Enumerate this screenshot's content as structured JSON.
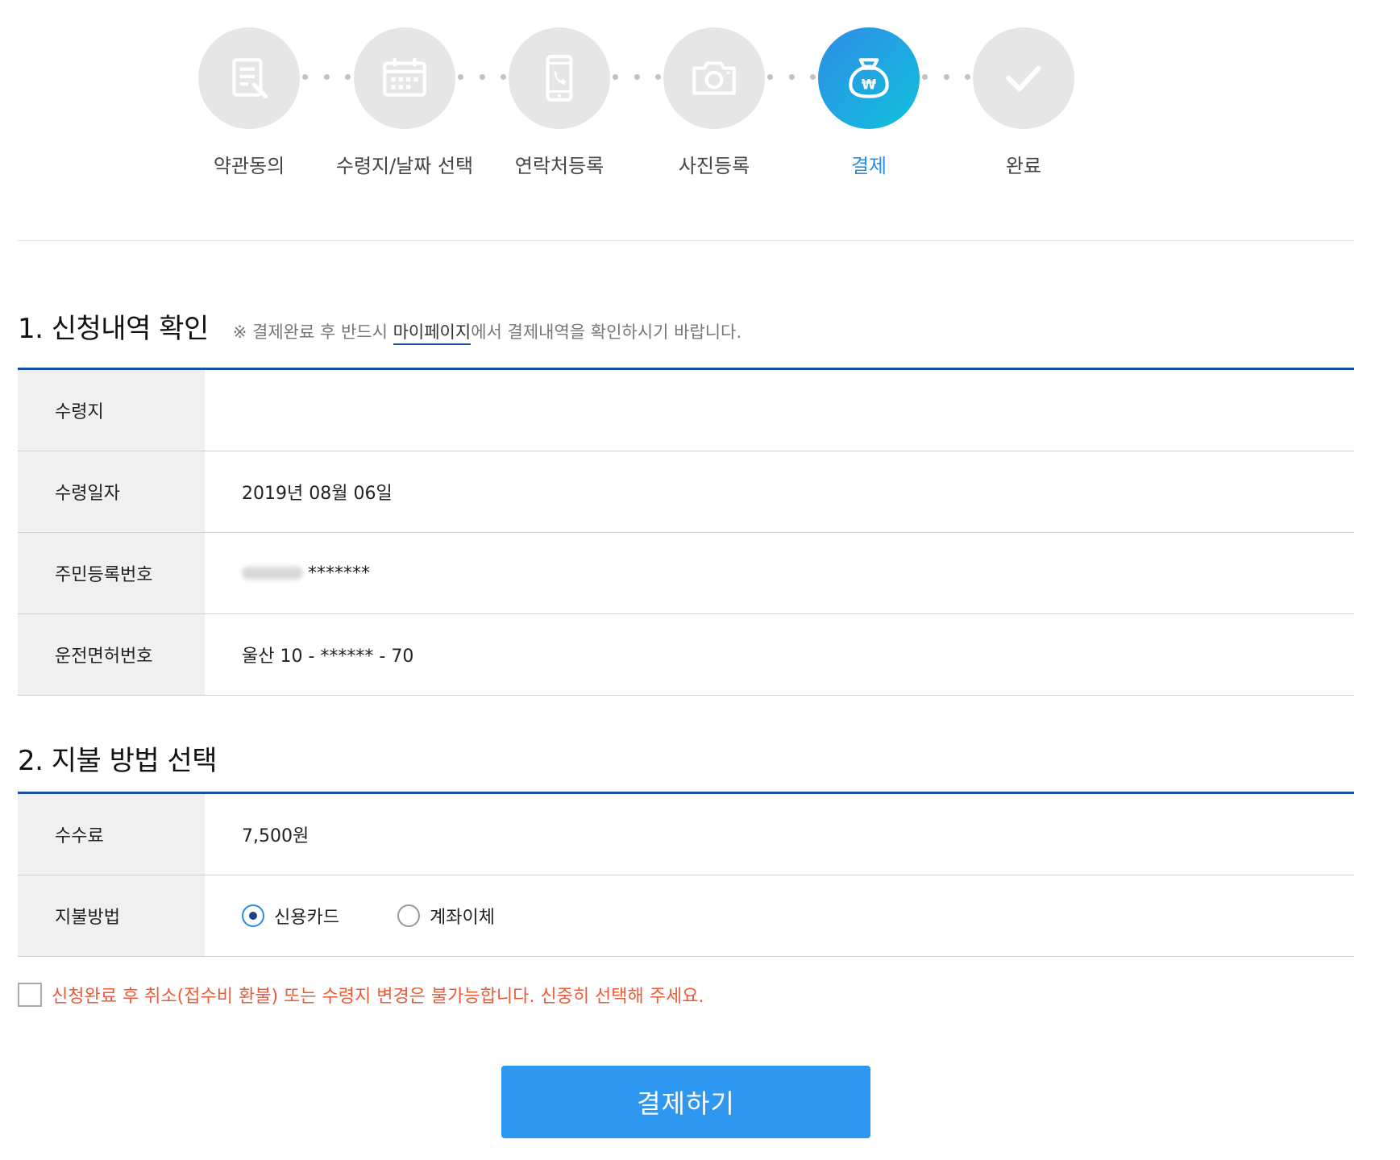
{
  "colors": {
    "accent": "#2b8ce8",
    "table_border": "#1c4fa3",
    "warning": "#ea5b3a",
    "button": "#2e97f0",
    "step_inactive": "#e6e6e6"
  },
  "stepper": {
    "steps": [
      {
        "label": "약관동의",
        "icon": "document-icon",
        "active": false
      },
      {
        "label": "수령지/날짜 선택",
        "icon": "calendar-icon",
        "active": false
      },
      {
        "label": "연락처등록",
        "icon": "phone-icon",
        "active": false
      },
      {
        "label": "사진등록",
        "icon": "camera-icon",
        "active": false
      },
      {
        "label": "결제",
        "icon": "payment-bag-icon",
        "active": true
      },
      {
        "label": "완료",
        "icon": "checkmark-icon",
        "active": false
      }
    ]
  },
  "section1": {
    "title": "1. 신청내역 확인",
    "note_prefix": "※ 결제완료 후 반드시 ",
    "note_link": "마이페이지",
    "note_suffix": "에서 결제내역을 확인하시기 바랍니다.",
    "rows": [
      {
        "label": "수령지",
        "value": ""
      },
      {
        "label": "수령일자",
        "value": "2019년 08월 06일"
      },
      {
        "label": "주민등록번호",
        "value": "*******"
      },
      {
        "label": "운전면허번호",
        "value": "울산 10 - ****** - 70"
      }
    ]
  },
  "section2": {
    "title": "2. 지불 방법 선택",
    "fee_label": "수수료",
    "fee_value": "7,500원",
    "method_label": "지불방법",
    "methods": [
      {
        "label": "신용카드",
        "checked": true
      },
      {
        "label": "계좌이체",
        "checked": false
      }
    ]
  },
  "agreement": {
    "text": "신청완료 후 취소(접수비 환불) 또는 수령지 변경은 불가능합니다. 신중히 선택해 주세요.",
    "checked": false
  },
  "pay_button": {
    "label": "결제하기"
  }
}
